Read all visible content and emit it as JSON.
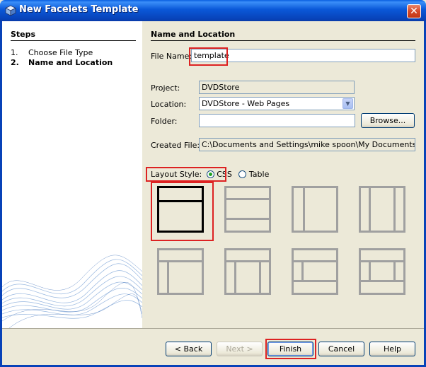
{
  "window": {
    "title": "New Facelets Template",
    "close_label": "✕"
  },
  "steps": {
    "title": "Steps",
    "items": [
      {
        "num": "1.",
        "label": "Choose File Type"
      },
      {
        "num": "2.",
        "label": "Name and Location"
      }
    ]
  },
  "main": {
    "section_title": "Name and Location",
    "file_name": {
      "label": "File Name:",
      "value": "template"
    },
    "project": {
      "label": "Project:",
      "value": "DVDStore"
    },
    "location": {
      "label": "Location:",
      "value": "DVDStore - Web Pages"
    },
    "folder": {
      "label": "Folder:",
      "value": "",
      "browse_label": "Browse..."
    },
    "created_file": {
      "label": "Created File:",
      "value": "C:\\Documents and Settings\\mike spoon\\My Documents\\NetBea"
    },
    "layout_style": {
      "label": "Layout Style:",
      "options": [
        "CSS",
        "Table"
      ],
      "selected": "CSS"
    }
  },
  "buttons": {
    "back": "< Back",
    "next": "Next >",
    "finish": "Finish",
    "cancel": "Cancel",
    "help": "Help"
  },
  "colors": {
    "accent_highlight": "#dd2222",
    "title_bar": "#0a58d8"
  }
}
